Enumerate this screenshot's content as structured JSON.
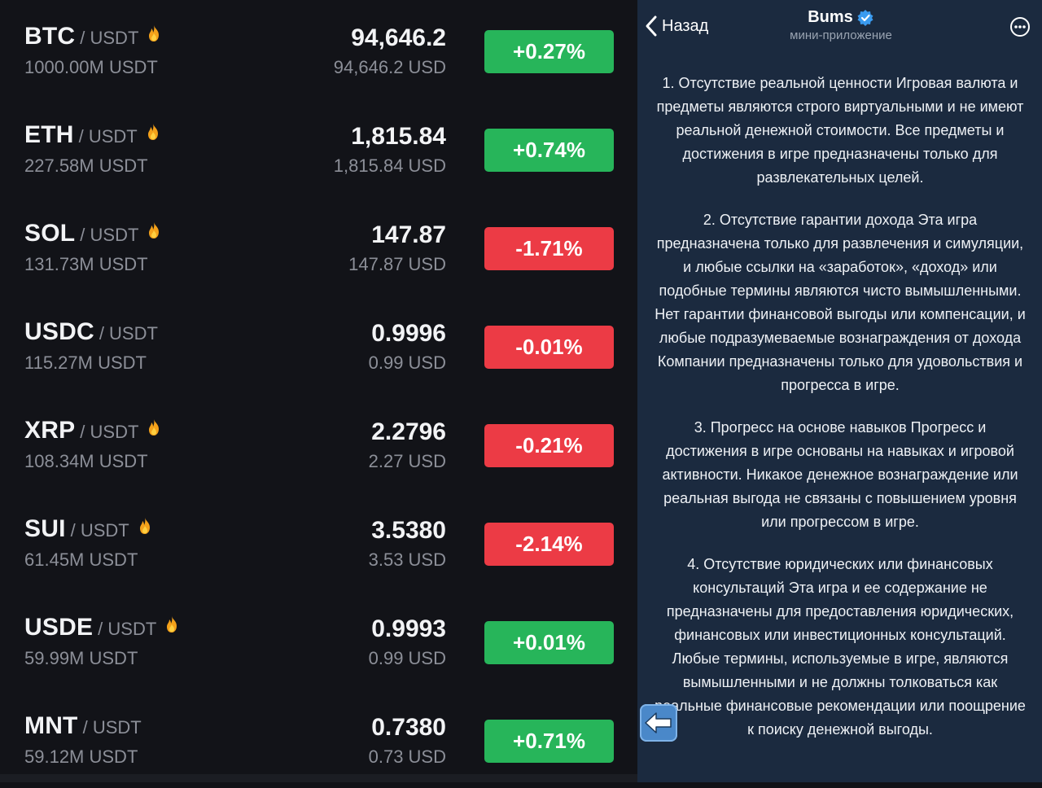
{
  "market": {
    "rows": [
      {
        "base": "BTC",
        "quote": "/ USDT",
        "volume": "1000.00M USDT",
        "price": "94,646.2",
        "usd": "94,646.2 USD",
        "change": "+0.27%",
        "direction": "up",
        "hot": true
      },
      {
        "base": "ETH",
        "quote": "/ USDT",
        "volume": "227.58M USDT",
        "price": "1,815.84",
        "usd": "1,815.84 USD",
        "change": "+0.74%",
        "direction": "up",
        "hot": true
      },
      {
        "base": "SOL",
        "quote": "/ USDT",
        "volume": "131.73M USDT",
        "price": "147.87",
        "usd": "147.87 USD",
        "change": "-1.71%",
        "direction": "down",
        "hot": true
      },
      {
        "base": "USDC",
        "quote": "/ USDT",
        "volume": "115.27M USDT",
        "price": "0.9996",
        "usd": "0.99 USD",
        "change": "-0.01%",
        "direction": "down",
        "hot": false
      },
      {
        "base": "XRP",
        "quote": "/ USDT",
        "volume": "108.34M USDT",
        "price": "2.2796",
        "usd": "2.27 USD",
        "change": "-0.21%",
        "direction": "down",
        "hot": true
      },
      {
        "base": "SUI",
        "quote": "/ USDT",
        "volume": "61.45M USDT",
        "price": "3.5380",
        "usd": "3.53 USD",
        "change": "-2.14%",
        "direction": "down",
        "hot": true
      },
      {
        "base": "USDE",
        "quote": "/ USDT",
        "volume": "59.99M USDT",
        "price": "0.9993",
        "usd": "0.99 USD",
        "change": "+0.01%",
        "direction": "up",
        "hot": true
      },
      {
        "base": "MNT",
        "quote": "/ USDT",
        "volume": "59.12M USDT",
        "price": "0.7380",
        "usd": "0.73 USD",
        "change": "+0.71%",
        "direction": "up",
        "hot": false
      }
    ]
  },
  "panel": {
    "back_label": "Назад",
    "title": "Bums",
    "subtitle": "мини-приложение",
    "paragraphs": [
      "1. Отсутствие реальной ценности Игровая валюта и предметы являются строго виртуальными и не имеют реальной денежной стоимости. Все предметы и достижения в игре предназначены только для развлекательных целей.",
      "2. Отсутствие гарантии дохода Эта игра предназначена только для развлечения и симуляции, и любые ссылки на «заработок», «доход» или подобные термины являются чисто вымышленными. Нет гарантии финансовой выгоды или компенсации, и любые подразумеваемые вознаграждения от дохода Компании предназначены только для удовольствия и прогресса в игре.",
      "3. Прогресс на основе навыков Прогресс и достижения в игре основаны на навыках и игровой активности. Никакое денежное вознаграждение или реальная выгода не связаны с повышением уровня или прогрессом в игре.",
      "4. Отсутствие юридических или финансовых консультаций Эта игра и ее содержание не предназначены для предоставления юридических, финансовых или инвестиционных консультаций. Любые термины, используемые в игре, являются вымышленными и не должны толковаться как реальные финансовые рекомендации или поощрение к поиску денежной выгоды."
    ]
  },
  "colors": {
    "up": "#27b55a",
    "down": "#ec3b45",
    "panel_bg": "#1b2a3f",
    "verified": "#3a9bf0"
  },
  "icons": {
    "back": "chevron-left-icon",
    "verified": "verified-badge-icon",
    "more": "more-options-icon",
    "hot": "fire-icon",
    "float": "arrow-left-icon"
  }
}
